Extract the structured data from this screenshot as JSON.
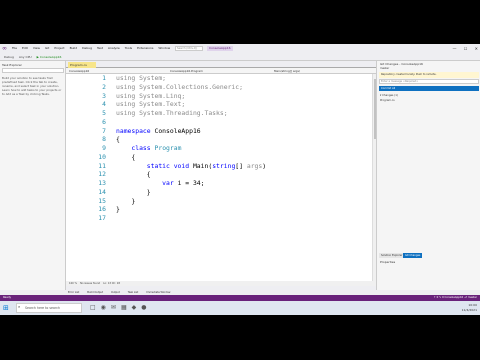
{
  "window": {
    "menu_items": [
      "File",
      "Edit",
      "View",
      "Git",
      "Project",
      "Build",
      "Debug",
      "Test",
      "Analyze",
      "Tools",
      "Extensions",
      "Window",
      "Help"
    ],
    "search_placeholder": "Search (Ctrl+Q)",
    "solution_name": "ConsoleApp16",
    "controls": [
      "—",
      "☐",
      "✕"
    ]
  },
  "toolbar": {
    "config": "Debug",
    "platform": "Any CPU",
    "run_label": "▶ ConsoleApp16"
  },
  "task_panel": {
    "title": "Task Explorer",
    "text": "Build your solution to see tasks from predefined task. Click the tab to create, rename, and select task in your solution. Learn how to add tasks to your projects or to Add as a Task by clicking Tasks."
  },
  "editor": {
    "tab_label": "Program.cs",
    "nav_left": "ConsoleApp16",
    "nav_mid": "ConsoleApp16.Program",
    "nav_right": "Main(string[] args)",
    "line_numbers": [
      "1",
      "2",
      "3",
      "4",
      "5",
      "6",
      "7",
      "8",
      "9",
      "10",
      "11",
      "12",
      "13",
      "14",
      "15",
      "16",
      "17"
    ],
    "lines": [
      {
        "segs": [
          {
            "t": "using System;",
            "c": "dim"
          }
        ]
      },
      {
        "segs": [
          {
            "t": "using System.Collections.Generic;",
            "c": "dim"
          }
        ]
      },
      {
        "segs": [
          {
            "t": "using System.Linq;",
            "c": "dim"
          }
        ]
      },
      {
        "segs": [
          {
            "t": "using System.Text;",
            "c": "dim"
          }
        ]
      },
      {
        "segs": [
          {
            "t": "using System.Threading.Tasks;",
            "c": "dim"
          }
        ]
      },
      {
        "segs": [
          {
            "t": "",
            "c": ""
          }
        ]
      },
      {
        "segs": [
          {
            "t": "namespace",
            "c": "kw"
          },
          {
            "t": " ConsoleApp16",
            "c": ""
          }
        ]
      },
      {
        "segs": [
          {
            "t": "{",
            "c": ""
          }
        ]
      },
      {
        "segs": [
          {
            "t": "    ",
            "c": ""
          },
          {
            "t": "class",
            "c": "kw"
          },
          {
            "t": " ",
            "c": ""
          },
          {
            "t": "Program",
            "c": "ty"
          }
        ]
      },
      {
        "segs": [
          {
            "t": "    {",
            "c": ""
          }
        ]
      },
      {
        "segs": [
          {
            "t": "        ",
            "c": ""
          },
          {
            "t": "static void",
            "c": "kw"
          },
          {
            "t": " Main(",
            "c": ""
          },
          {
            "t": "string",
            "c": "kw"
          },
          {
            "t": "[] ",
            "c": ""
          },
          {
            "t": "args",
            "c": "dim"
          },
          {
            "t": ")",
            "c": ""
          }
        ]
      },
      {
        "segs": [
          {
            "t": "        {",
            "c": ""
          }
        ]
      },
      {
        "segs": [
          {
            "t": "            ",
            "c": ""
          },
          {
            "t": "var",
            "c": "kw"
          },
          {
            "t": " i = 34;",
            "c": ""
          }
        ]
      },
      {
        "segs": [
          {
            "t": "        }",
            "c": ""
          }
        ]
      },
      {
        "segs": [
          {
            "t": "    }",
            "c": ""
          }
        ]
      },
      {
        "segs": [
          {
            "t": "}",
            "c": ""
          }
        ]
      },
      {
        "segs": [
          {
            "t": "",
            "c": ""
          }
        ]
      }
    ],
    "zoom": "100 %",
    "issues": "No issues found",
    "position": "Ln: 13  Ch: 18"
  },
  "git_panel": {
    "title": "Git Changes - ConsoleApp16",
    "branch": "master",
    "warning": "Repository created locally. Push to remote.",
    "message_placeholder": "Enter a message <Required>",
    "commit_label": "Commit All",
    "changes_1": "▾ Changes (1)",
    "changes_2": "  Program.cs"
  },
  "right_tabs": [
    "Solution Explorer",
    "Git Changes"
  ],
  "properties_title": "Properties",
  "bottom_tabs": [
    "Error List",
    "Build Output",
    "Output",
    "Task List",
    "Immediate Window"
  ],
  "statusbar": {
    "left": "Ready",
    "right": "↑ 0  ✎ 0  ConsoleApp16  ⎇ master"
  },
  "taskbar": {
    "search_placeholder": "Search here to search",
    "apps": [
      "□",
      "◉",
      "✉",
      "▦",
      "◆",
      "●"
    ],
    "time": "10:00",
    "date": "11/4/2021"
  }
}
